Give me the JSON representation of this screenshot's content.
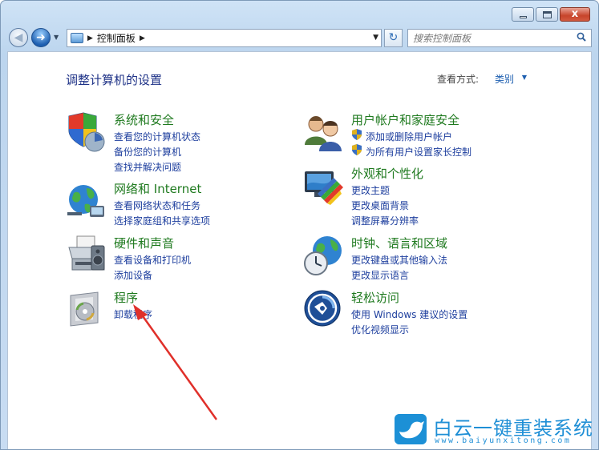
{
  "window": {
    "address_path": "控制面板",
    "search_placeholder": "搜索控制面板",
    "close_glyph": "x"
  },
  "page": {
    "title": "调整计算机的设置",
    "viewby_label": "查看方式:",
    "viewby_value": "类别"
  },
  "categories": [
    {
      "title": "系统和安全",
      "links": [
        "查看您的计算机状态",
        "备份您的计算机",
        "查找并解决问题"
      ]
    },
    {
      "title": "网络和 Internet",
      "links": [
        "查看网络状态和任务",
        "选择家庭组和共享选项"
      ]
    },
    {
      "title": "硬件和声音",
      "links": [
        "查看设备和打印机",
        "添加设备"
      ]
    },
    {
      "title": "程序",
      "links": [
        "卸载程序"
      ]
    },
    {
      "title": "用户帐户和家庭安全",
      "links": [
        "添加或删除用户帐户",
        "为所有用户设置家长控制"
      ]
    },
    {
      "title": "外观和个性化",
      "links": [
        "更改主题",
        "更改桌面背景",
        "调整屏幕分辨率"
      ]
    },
    {
      "title": "时钟、语言和区域",
      "links": [
        "更改键盘或其他输入法",
        "更改显示语言"
      ]
    },
    {
      "title": "轻松访问",
      "links": [
        "使用 Windows 建议的设置",
        "优化视频显示"
      ]
    }
  ],
  "watermark": {
    "title": "白云一键重装系统",
    "url": "www.baiyunxitong.com"
  },
  "colors": {
    "category_title": "#1f7a1f",
    "link": "#1e3f9e",
    "page_title": "#1e3287",
    "annotation_arrow": "#e0302a",
    "watermark": "#1f8fd6"
  }
}
